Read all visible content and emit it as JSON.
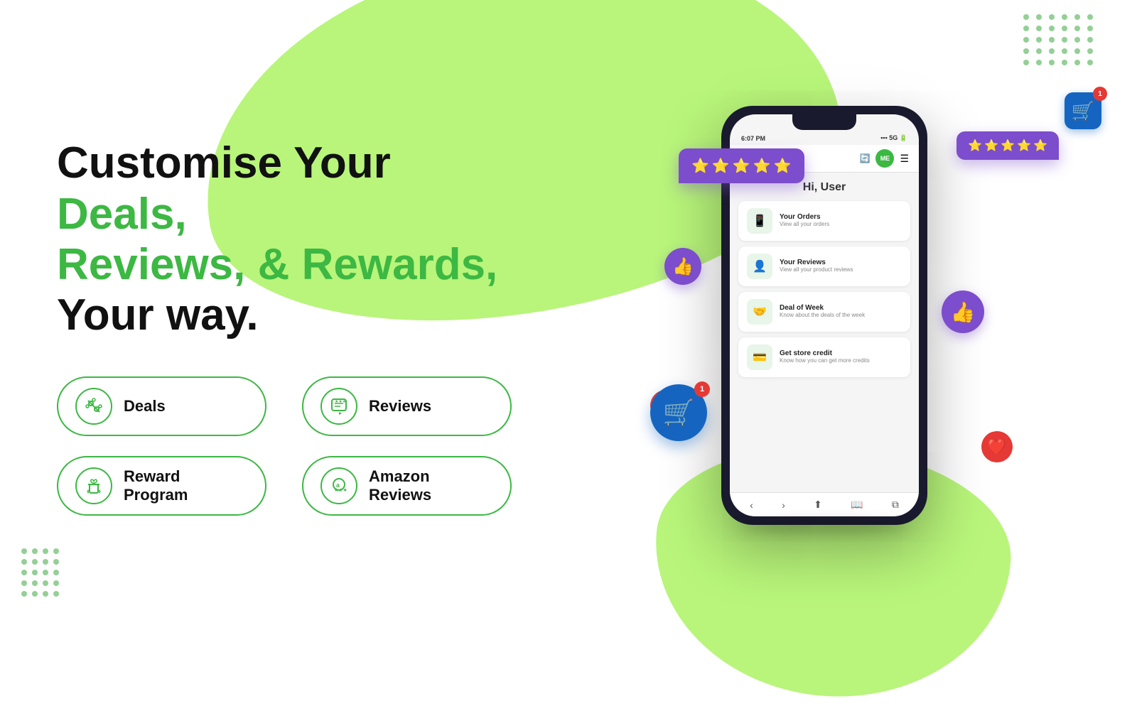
{
  "page": {
    "title": "Customise Your Deals, Reviews, & Rewards, Your way.",
    "title_part1": "Customise Your ",
    "title_green": "Deals,\nReviews, & Rewards,",
    "title_part3": "\nYour way."
  },
  "features": [
    {
      "id": "deals",
      "label": "Deals",
      "icon": "💠"
    },
    {
      "id": "reviews",
      "label": "Reviews",
      "icon": "⭐"
    },
    {
      "id": "reward-program",
      "label": "Reward Program",
      "icon": "🎁"
    },
    {
      "id": "amazon-reviews",
      "label": "Amazon Reviews",
      "icon": "🅰"
    }
  ],
  "phone": {
    "time": "6:07 PM",
    "signal": "5G",
    "greeting": "Hi, User",
    "menu_items": [
      {
        "title": "Your Orders",
        "subtitle": "View all your orders",
        "icon": "📦"
      },
      {
        "title": "Your Reviews",
        "subtitle": "View all your product reviews",
        "icon": "👤"
      },
      {
        "title": "Deal of Week",
        "subtitle": "Know about the deals of the week",
        "icon": "🤝"
      },
      {
        "title": "Get store credit",
        "subtitle": "Know how you can get more credits",
        "icon": "💳"
      }
    ],
    "nav_avatar": "ME"
  },
  "floating": {
    "stars_count": 5,
    "stars_right_count": 5,
    "thumbs_up": "👍",
    "heart": "❤️",
    "cart_badge": "1"
  },
  "colors": {
    "green": "#3cb843",
    "light_green": "#b8f57a",
    "purple": "#7c4dcc",
    "red": "#e53935",
    "blue": "#1565C0"
  }
}
